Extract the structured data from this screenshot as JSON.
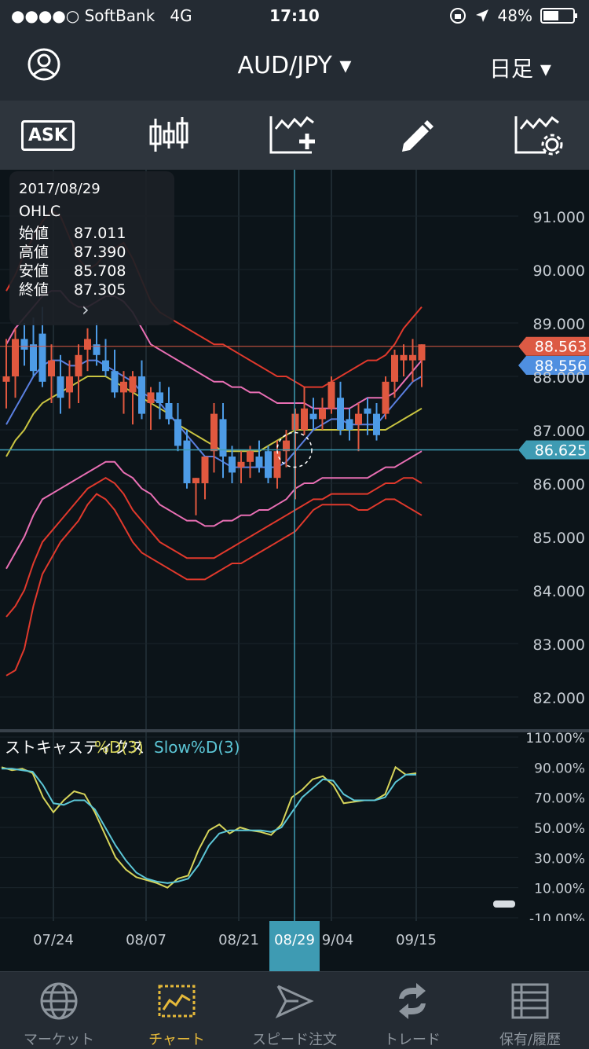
{
  "status": {
    "carrier": "●●●●○ SoftBank",
    "network": "4G",
    "time": "17:10",
    "battery": "48%"
  },
  "header": {
    "pair": "AUD/JPY ▾",
    "timeframe": "日足 ▾",
    "account_icon": "account-icon"
  },
  "toolbar": {
    "ask_label": "ASK"
  },
  "ohlc": {
    "date": "2017/08/29",
    "title": "OHLC",
    "open_label": "始値",
    "open": "87.011",
    "high_label": "高値",
    "high": "87.390",
    "low_label": "安値",
    "low": "85.708",
    "close_label": "終値",
    "close": "87.305",
    "next": "›"
  },
  "price_axis": {
    "ticks": [
      "91.000",
      "90.000",
      "89.000",
      "88.000",
      "87.000",
      "86.000",
      "85.000",
      "84.000",
      "83.000",
      "82.000"
    ],
    "ask_label": "88.563",
    "bid_label": "88.556",
    "cursor_label": "86.625",
    "colors": {
      "ask": "#dc5a44",
      "bid": "#4f8fe0",
      "cursor": "#3e9bb3"
    }
  },
  "stoch": {
    "title": "ストキャスティクス",
    "d_label": "%D(3)",
    "slowd_label": "Slow%D(3)",
    "ticks": [
      "110.00%",
      "90.00%",
      "70.00%",
      "50.00%",
      "30.00%",
      "10.00%",
      "-10.00%"
    ],
    "colors": {
      "d": "#d6d45a",
      "slowd": "#5cc6d6"
    }
  },
  "xaxis": {
    "labels": [
      "07/24",
      "08/07",
      "08/21",
      "9/04",
      "09/15"
    ],
    "cursor": "08/29"
  },
  "tabs": [
    {
      "label": "マーケット",
      "icon": "globe-icon"
    },
    {
      "label": "チャート",
      "icon": "chart-icon"
    },
    {
      "label": "スピード注文",
      "icon": "speed-order-icon"
    },
    {
      "label": "トレード",
      "icon": "trade-icon"
    },
    {
      "label": "保有/履歴",
      "icon": "history-icon"
    }
  ],
  "chart_data": {
    "type": "candlestick",
    "ylim": [
      81.5,
      91.8
    ],
    "candles": [
      {
        "o": 87.9,
        "h": 88.7,
        "l": 87.4,
        "c": 88.0
      },
      {
        "o": 88.0,
        "h": 88.9,
        "l": 87.6,
        "c": 88.7
      },
      {
        "o": 88.7,
        "h": 89.0,
        "l": 88.2,
        "c": 88.5
      },
      {
        "o": 88.6,
        "h": 89.1,
        "l": 88.0,
        "c": 88.1
      },
      {
        "o": 88.8,
        "h": 89.3,
        "l": 87.8,
        "c": 87.9
      },
      {
        "o": 88.0,
        "h": 88.6,
        "l": 87.5,
        "c": 88.3
      },
      {
        "o": 88.0,
        "h": 88.4,
        "l": 87.3,
        "c": 87.6
      },
      {
        "o": 87.7,
        "h": 88.3,
        "l": 87.4,
        "c": 88.0
      },
      {
        "o": 88.0,
        "h": 88.6,
        "l": 87.5,
        "c": 88.4
      },
      {
        "o": 88.5,
        "h": 88.9,
        "l": 88.1,
        "c": 88.7
      },
      {
        "o": 88.6,
        "h": 89.0,
        "l": 88.2,
        "c": 88.4
      },
      {
        "o": 88.3,
        "h": 88.7,
        "l": 88.0,
        "c": 88.1
      },
      {
        "o": 88.1,
        "h": 88.5,
        "l": 87.6,
        "c": 87.7
      },
      {
        "o": 87.7,
        "h": 88.1,
        "l": 87.3,
        "c": 87.9
      },
      {
        "o": 87.7,
        "h": 88.1,
        "l": 87.1,
        "c": 88.0
      },
      {
        "o": 88.0,
        "h": 88.3,
        "l": 87.2,
        "c": 87.3
      },
      {
        "o": 87.5,
        "h": 87.8,
        "l": 87.0,
        "c": 87.7
      },
      {
        "o": 87.7,
        "h": 87.9,
        "l": 87.2,
        "c": 87.5
      },
      {
        "o": 87.5,
        "h": 87.8,
        "l": 87.1,
        "c": 87.2
      },
      {
        "o": 87.2,
        "h": 87.5,
        "l": 86.6,
        "c": 86.7
      },
      {
        "o": 86.8,
        "h": 87.0,
        "l": 85.9,
        "c": 86.0
      },
      {
        "o": 86.0,
        "h": 86.1,
        "l": 85.4,
        "c": 86.1
      },
      {
        "o": 86.0,
        "h": 86.4,
        "l": 85.7,
        "c": 86.5
      },
      {
        "o": 86.6,
        "h": 87.5,
        "l": 86.2,
        "c": 87.3
      },
      {
        "o": 87.2,
        "h": 87.5,
        "l": 86.1,
        "c": 86.5
      },
      {
        "o": 86.5,
        "h": 86.7,
        "l": 86.0,
        "c": 86.2
      },
      {
        "o": 86.3,
        "h": 86.6,
        "l": 86.0,
        "c": 86.4
      },
      {
        "o": 86.4,
        "h": 86.7,
        "l": 86.1,
        "c": 86.6
      },
      {
        "o": 86.5,
        "h": 86.8,
        "l": 86.2,
        "c": 86.3
      },
      {
        "o": 86.6,
        "h": 86.7,
        "l": 86.0,
        "c": 86.1
      },
      {
        "o": 86.1,
        "h": 86.8,
        "l": 85.9,
        "c": 86.6
      },
      {
        "o": 86.6,
        "h": 87.0,
        "l": 86.3,
        "c": 86.8
      },
      {
        "o": 87.0,
        "h": 87.4,
        "l": 85.7,
        "c": 87.3
      },
      {
        "o": 87.0,
        "h": 87.8,
        "l": 86.9,
        "c": 87.4
      },
      {
        "o": 87.3,
        "h": 87.6,
        "l": 87.0,
        "c": 87.2
      },
      {
        "o": 87.2,
        "h": 87.6,
        "l": 87.0,
        "c": 87.4
      },
      {
        "o": 87.4,
        "h": 88.0,
        "l": 87.3,
        "c": 87.9
      },
      {
        "o": 87.6,
        "h": 87.9,
        "l": 86.9,
        "c": 87.0
      },
      {
        "o": 87.2,
        "h": 87.4,
        "l": 86.8,
        "c": 87.0
      },
      {
        "o": 87.1,
        "h": 87.5,
        "l": 86.6,
        "c": 87.3
      },
      {
        "o": 87.4,
        "h": 87.6,
        "l": 86.9,
        "c": 87.3
      },
      {
        "o": 87.3,
        "h": 87.5,
        "l": 86.8,
        "c": 86.9
      },
      {
        "o": 87.3,
        "h": 88.0,
        "l": 87.2,
        "c": 87.9
      },
      {
        "o": 87.9,
        "h": 88.5,
        "l": 87.6,
        "c": 88.4
      },
      {
        "o": 88.3,
        "h": 88.6,
        "l": 88.0,
        "c": 88.4
      },
      {
        "o": 88.3,
        "h": 88.7,
        "l": 87.9,
        "c": 88.4
      },
      {
        "o": 88.3,
        "h": 88.6,
        "l": 87.8,
        "c": 88.6
      }
    ],
    "sma": [
      86.5,
      86.8,
      87.0,
      87.3,
      87.5,
      87.6,
      87.7,
      87.8,
      87.9,
      88.0,
      88.0,
      88.0,
      87.9,
      87.8,
      87.7,
      87.6,
      87.5,
      87.4,
      87.3,
      87.1,
      87.0,
      86.9,
      86.8,
      86.7,
      86.6,
      86.6,
      86.6,
      86.6,
      86.6,
      86.7,
      86.8,
      86.9,
      87.0,
      87.0,
      87.0,
      87.0,
      87.0,
      87.0,
      87.0,
      87.0,
      87.0,
      87.0,
      87.0,
      87.1,
      87.2,
      87.3,
      87.4
    ],
    "ema": [
      87.1,
      87.4,
      87.7,
      88.0,
      88.2,
      88.3,
      88.3,
      88.2,
      88.2,
      88.3,
      88.3,
      88.2,
      88.1,
      88.0,
      87.9,
      87.7,
      87.6,
      87.5,
      87.3,
      87.1,
      86.9,
      86.7,
      86.5,
      86.5,
      86.4,
      86.3,
      86.3,
      86.3,
      86.3,
      86.3,
      86.3,
      86.4,
      86.6,
      86.8,
      87.0,
      87.1,
      87.2,
      87.2,
      87.1,
      87.1,
      87.1,
      87.1,
      87.3,
      87.5,
      87.7,
      87.9,
      88.0
    ],
    "bb_up2": [
      89.6,
      89.9,
      90.3,
      90.6,
      90.9,
      91.1,
      91.0,
      90.6,
      90.2,
      90.0,
      90.1,
      90.3,
      90.4,
      90.5,
      90.2,
      89.8,
      89.4,
      89.2,
      89.1,
      89.0,
      88.9,
      88.8,
      88.7,
      88.6,
      88.6,
      88.5,
      88.4,
      88.3,
      88.2,
      88.1,
      88.0,
      88.0,
      87.9,
      87.8,
      87.8,
      87.8,
      87.9,
      88.0,
      88.1,
      88.2,
      88.3,
      88.3,
      88.4,
      88.6,
      88.9,
      89.1,
      89.3
    ],
    "bb_up1": [
      88.6,
      88.9,
      89.1,
      89.3,
      89.5,
      89.6,
      89.6,
      89.4,
      89.3,
      89.3,
      89.4,
      89.5,
      89.5,
      89.4,
      89.2,
      88.9,
      88.6,
      88.5,
      88.4,
      88.3,
      88.2,
      88.1,
      88.0,
      87.9,
      87.9,
      87.8,
      87.8,
      87.7,
      87.7,
      87.6,
      87.5,
      87.5,
      87.5,
      87.5,
      87.4,
      87.4,
      87.4,
      87.4,
      87.4,
      87.5,
      87.6,
      87.6,
      87.6,
      87.7,
      87.9,
      88.1,
      88.3
    ],
    "bb_lo1": [
      84.4,
      84.7,
      85.0,
      85.4,
      85.7,
      85.8,
      85.9,
      86.0,
      86.1,
      86.2,
      86.3,
      86.4,
      86.4,
      86.2,
      86.1,
      85.9,
      85.8,
      85.6,
      85.5,
      85.4,
      85.3,
      85.3,
      85.2,
      85.2,
      85.3,
      85.3,
      85.4,
      85.4,
      85.5,
      85.5,
      85.6,
      85.7,
      85.9,
      86.0,
      86.0,
      86.1,
      86.1,
      86.1,
      86.1,
      86.1,
      86.1,
      86.2,
      86.3,
      86.3,
      86.4,
      86.5,
      86.6
    ],
    "bb_lo2": [
      83.5,
      83.7,
      84.0,
      84.5,
      84.9,
      85.1,
      85.3,
      85.5,
      85.7,
      85.9,
      86.0,
      86.1,
      86.0,
      85.8,
      85.5,
      85.3,
      85.1,
      84.9,
      84.8,
      84.7,
      84.6,
      84.6,
      84.6,
      84.6,
      84.7,
      84.8,
      84.9,
      85.0,
      85.1,
      85.2,
      85.3,
      85.4,
      85.5,
      85.6,
      85.7,
      85.7,
      85.8,
      85.8,
      85.8,
      85.8,
      85.8,
      85.9,
      86.0,
      86.0,
      86.1,
      86.1,
      86.0
    ],
    "bb_lo3": [
      82.4,
      82.5,
      82.9,
      83.7,
      84.3,
      84.6,
      84.9,
      85.1,
      85.3,
      85.6,
      85.8,
      85.7,
      85.5,
      85.2,
      84.9,
      84.7,
      84.6,
      84.5,
      84.4,
      84.3,
      84.2,
      84.2,
      84.2,
      84.3,
      84.4,
      84.5,
      84.5,
      84.6,
      84.7,
      84.8,
      84.9,
      85.0,
      85.1,
      85.3,
      85.5,
      85.6,
      85.6,
      85.6,
      85.6,
      85.5,
      85.5,
      85.6,
      85.7,
      85.7,
      85.6,
      85.5,
      85.4
    ],
    "stoch_d": [
      90,
      88,
      89,
      86,
      70,
      60,
      68,
      74,
      72,
      60,
      45,
      30,
      22,
      17,
      15,
      13,
      10,
      16,
      18,
      35,
      48,
      52,
      46,
      50,
      48,
      47,
      45,
      52,
      70,
      75,
      82,
      84,
      78,
      66,
      67,
      68,
      68,
      72,
      90,
      85,
      86
    ],
    "stoch_slowd": [
      89,
      89,
      88,
      87,
      78,
      66,
      65,
      68,
      68,
      62,
      50,
      38,
      28,
      20,
      16,
      14,
      13,
      14,
      16,
      25,
      38,
      46,
      48,
      48,
      48,
      48,
      47,
      50,
      60,
      70,
      76,
      82,
      81,
      72,
      68,
      68,
      68,
      70,
      80,
      85,
      85
    ]
  }
}
